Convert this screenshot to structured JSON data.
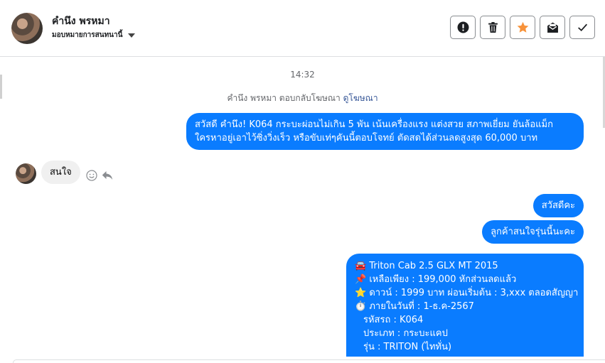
{
  "header": {
    "contact_name": "คำนึง พรหมา",
    "assign_label": "มอบหมายการสนทนานี้"
  },
  "toolbar": {
    "buttons": [
      {
        "name": "report-button",
        "icon": "exclamation-icon"
      },
      {
        "name": "delete-button",
        "icon": "trash-icon"
      },
      {
        "name": "star-button",
        "icon": "star-icon"
      },
      {
        "name": "mark-unread-button",
        "icon": "envelope-icon"
      },
      {
        "name": "mark-done-button",
        "icon": "check-icon"
      }
    ],
    "star_color": "#f7923a"
  },
  "conversation": {
    "timestamp": "14:32",
    "reply_note": "คำนึง พรหมา ตอบกลับโฆษณา",
    "reply_link": "ดูโฆษณา",
    "outgoing_1": {
      "lines": [
        "สวัสดี คำนึง! K064 กระบะผ่อนไม่เกิน 5 พัน เน้นเครื่องแรง แต่งสวย สภาพเยี่ยม ยันล้อแม็ก",
        "ใครหาอยู่เอาไว้ซิ่งวิ่งเร็ว หรือขับเท่ๆคันนี้ตอบโจทย์ ตัดสดได้ส่วนลดสูงสุด 60,000 บาท"
      ]
    },
    "incoming_1": "สนใจ",
    "outgoing_2": "สวัสดีคะ",
    "outgoing_3": "ลูกค้าสนใจรุ่นนี้นะคะ",
    "outgoing_4": {
      "lines": [
        {
          "emoji": "🚘",
          "text": "Triton Cab 2.5 GLX MT 2015"
        },
        {
          "emoji": "📌",
          "text": "เหลือเพียง : 199,000 หักส่วนลดแล้ว"
        },
        {
          "emoji": "⭐",
          "text": "ดาวน์ : 1999 บาท ผ่อนเริ่มต้น : 3,xxx ตลอดสัญญา"
        },
        {
          "emoji": "⏱️",
          "text": "ภายในวันที่ : 1-ธ.ค-2567"
        },
        {
          "emoji": "",
          "text": "รหัสรถ : K064"
        },
        {
          "emoji": "",
          "text": "ประเภท : กระบะแคป"
        },
        {
          "emoji": "",
          "text": "รุ่น : TRITON (ไททั่น)"
        }
      ]
    }
  },
  "colors": {
    "outgoing_bubble": "#0a7cff",
    "incoming_bubble": "#f0f0f0",
    "link": "#385898"
  }
}
